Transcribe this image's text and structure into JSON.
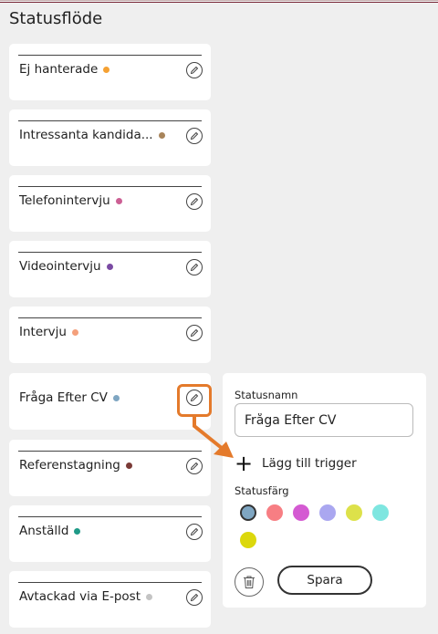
{
  "page": {
    "title": "Statusflöde"
  },
  "statuses": [
    {
      "label": "Ej hanterade",
      "color": "#f5a133"
    },
    {
      "label": "Intressanta kandida...",
      "color": "#a8845a"
    },
    {
      "label": "Telefonintervju",
      "color": "#cc5f94"
    },
    {
      "label": "Videointervju",
      "color": "#7a4aa3"
    },
    {
      "label": "Intervju",
      "color": "#f4a07b"
    },
    {
      "label": "Fråga Efter CV",
      "color": "#7fa6c2"
    },
    {
      "label": "Referenstagning",
      "color": "#7a3a36"
    },
    {
      "label": "Anställd",
      "color": "#1f9a87"
    },
    {
      "label": "Avtackad via E-post",
      "color": "#c4c4c4"
    }
  ],
  "edit_panel": {
    "name_label": "Statusnamn",
    "name_value": "Fråga Efter CV",
    "add_trigger_label": "Lägg till trigger",
    "color_label": "Statusfärg",
    "colors": [
      "#7fa6c2",
      "#f77e83",
      "#d45ad2",
      "#aaa7f0",
      "#dde14a",
      "#7ee6e0",
      "#dcd80c"
    ],
    "selected_color_index": 0,
    "save_label": "Spara"
  },
  "accent": "#e47a2b"
}
